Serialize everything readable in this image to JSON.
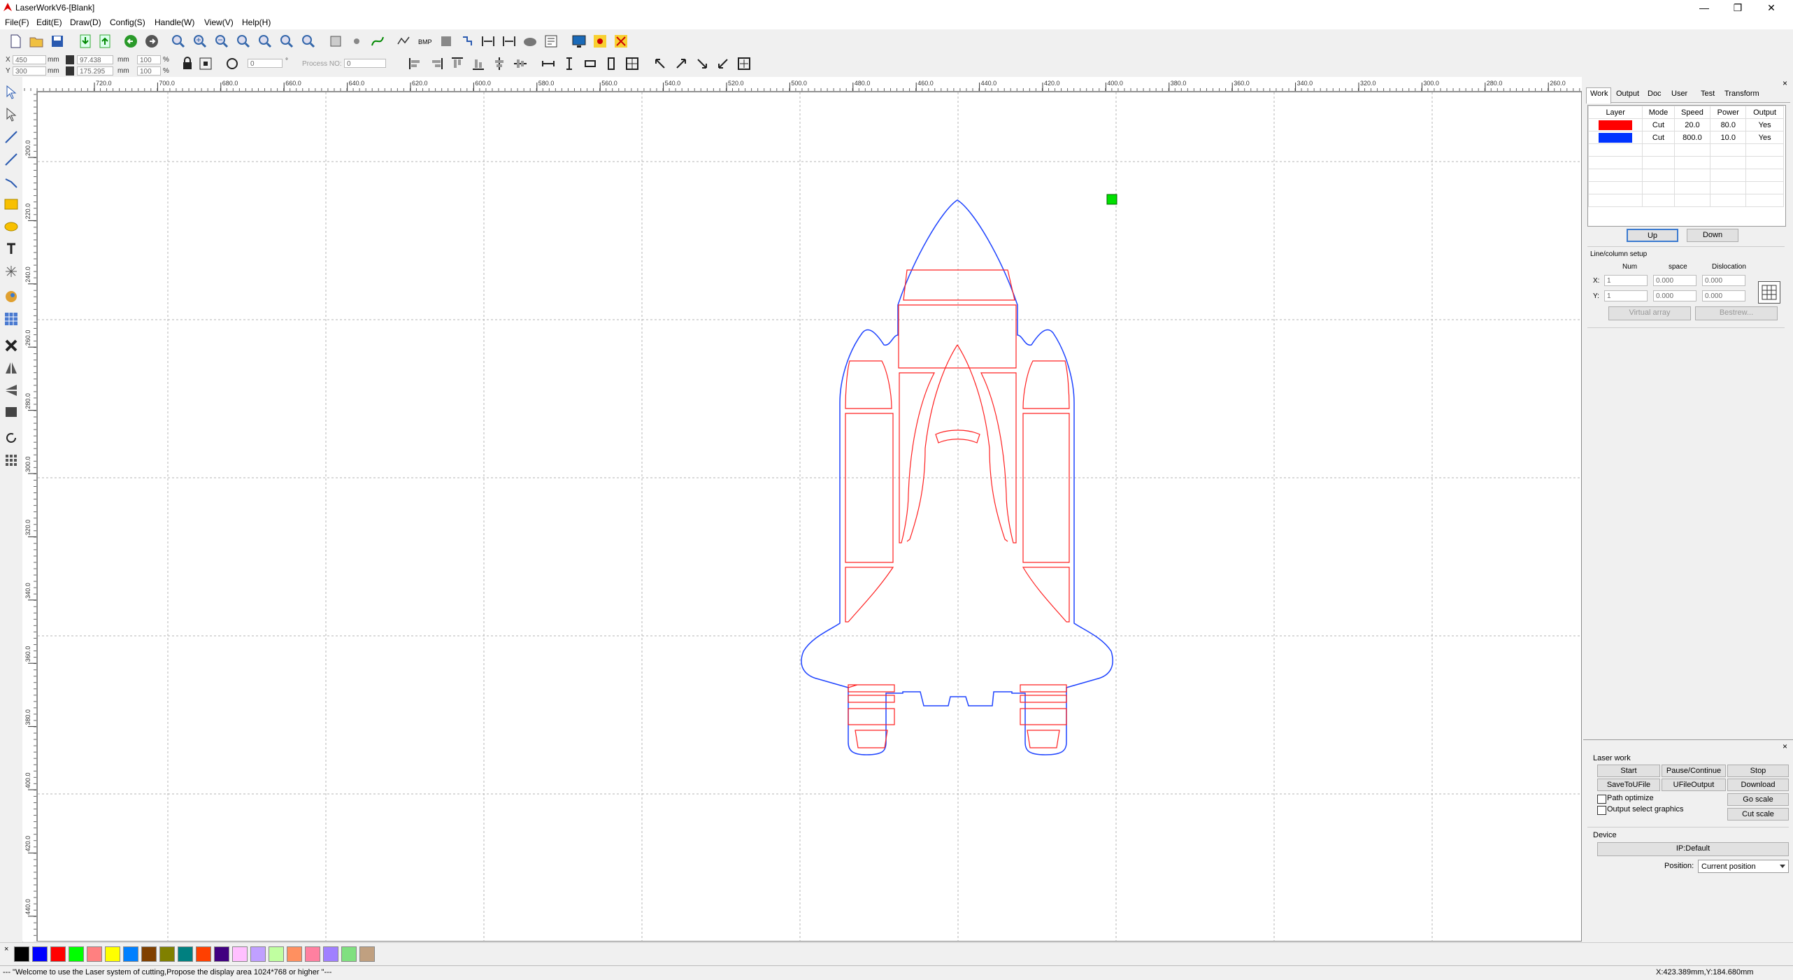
{
  "window": {
    "title": "LaserWorkV6-[Blank]",
    "controls": {
      "minimize": "—",
      "maximize": "❐",
      "close": "✕"
    }
  },
  "menu": [
    "File(F)",
    "Edit(E)",
    "Draw(D)",
    "Config(S)",
    "Handle(W)",
    "View(V)",
    "Help(H)"
  ],
  "toolbar2": {
    "x_label": "X",
    "x_value": "450",
    "y_label": "Y",
    "y_value": "300",
    "unit": "mm",
    "width_value": "97.438",
    "height_value": "175.295",
    "scale_x": "100",
    "scale_y": "100",
    "percent": "%",
    "rotate_value": "0",
    "degree": "°",
    "process_label": "Process NO:",
    "process_value": "0"
  },
  "ruler": {
    "h_labels": [
      "720.0",
      "700.0",
      "680.0",
      "660.0",
      "640.0",
      "620.0",
      "600.0",
      "580.0",
      "560.0",
      "540.0",
      "520.0",
      "500.0",
      "480.0",
      "460.0",
      "440.0",
      "420.0",
      "400.0",
      "380.0",
      "360.0",
      "340.0",
      "320.0",
      "300.0",
      "280.0",
      "260.0"
    ],
    "v_labels": [
      "200.0",
      "220.0",
      "240.0",
      "260.0",
      "280.0",
      "300.0",
      "320.0",
      "340.0",
      "360.0",
      "380.0",
      "400.0",
      "420.0",
      "440.0"
    ]
  },
  "panel": {
    "tabs": [
      "Work",
      "Output",
      "Doc",
      "User",
      "Test",
      "Transform"
    ],
    "layer_headers": [
      "Layer",
      "Mode",
      "Speed",
      "Power",
      "Output"
    ],
    "layers": [
      {
        "color": "#ff0000",
        "mode": "Cut",
        "speed": "20.0",
        "power": "80.0",
        "output": "Yes"
      },
      {
        "color": "#0033ff",
        "mode": "Cut",
        "speed": "800.0",
        "power": "10.0",
        "output": "Yes"
      }
    ],
    "up_label": "Up",
    "down_label": "Down",
    "array": {
      "title": "Line/column setup",
      "num_label": "Num",
      "space_label": "space",
      "dislocation_label": "Dislocation",
      "x_label": "X:",
      "y_label": "Y:",
      "x_num": "1",
      "x_space": "0.000",
      "x_disl": "0.000",
      "y_num": "1",
      "y_space": "0.000",
      "y_disl": "0.000",
      "virtual_array": "Virtual array",
      "bestrew": "Bestrew..."
    },
    "laser_work": {
      "title": "Laser work",
      "start": "Start",
      "pause": "Pause/Continue",
      "stop": "Stop",
      "save_file": "SaveToUFile",
      "ufile_output": "UFileOutput",
      "download": "Download",
      "path_optimize": "Path optimize",
      "output_select": "Output select graphics",
      "go_scale": "Go scale",
      "cut_scale": "Cut scale"
    },
    "device": {
      "title": "Device",
      "ip": "IP:Default",
      "position_label": "Position:",
      "position_value": "Current position"
    },
    "close_glyph": "×"
  },
  "palette_colors": [
    "#000000",
    "#0000ff",
    "#ff0000",
    "#00ff00",
    "#ff8080",
    "#ffff00",
    "#0080ff",
    "#804000",
    "#808000",
    "#008080",
    "#ff4000",
    "#400080",
    "#ffc0ff",
    "#c0a0ff",
    "#c0ffa0",
    "#ff9060",
    "#ff80a0",
    "#a080ff",
    "#80e080",
    "#c0a080"
  ],
  "status": {
    "message": "--- \"Welcome to use the Laser system of cutting,Propose the display area 1024*768 or higher \"---",
    "coords": "X:423.389mm,Y:184.680mm"
  },
  "colors": {
    "layer_red": "#ff0000",
    "layer_blue": "#0033ff",
    "handle_green": "#00e000"
  }
}
